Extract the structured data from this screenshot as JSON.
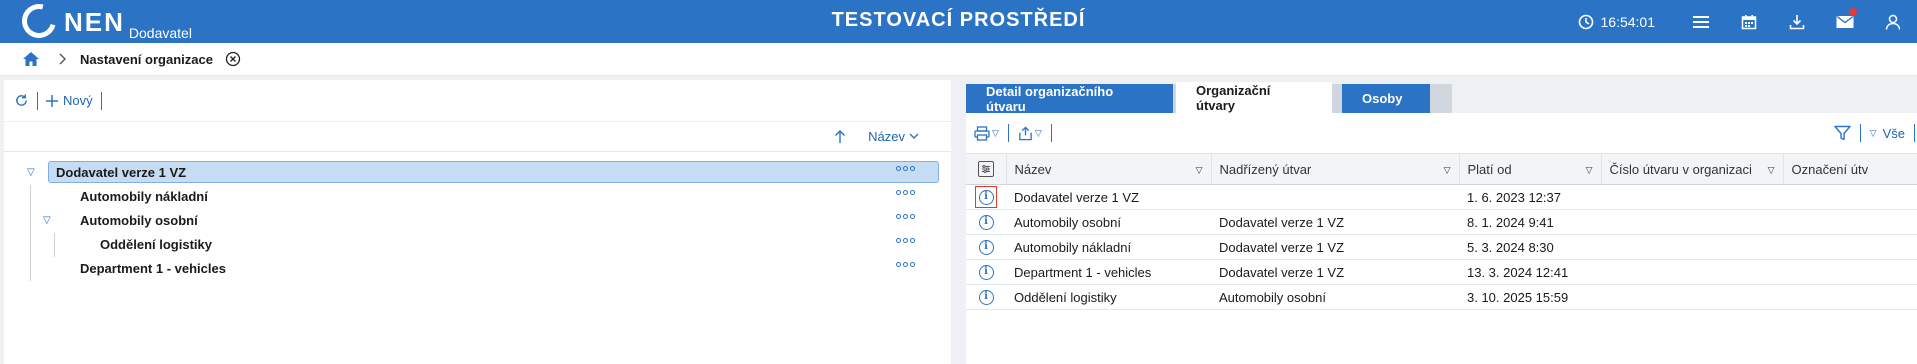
{
  "header": {
    "logo_text": "NEN",
    "logo_sub": "Dodavatel",
    "environment_title": "TESTOVACÍ PROSTŘEDÍ",
    "clock_time": "16:54:01",
    "accent_color": "#2b73c4",
    "icons": [
      "clock-icon",
      "menu-icon",
      "calendar-icon",
      "download-icon",
      "mail-icon",
      "user-icon"
    ]
  },
  "breadcrumb": {
    "title": "Nastavení organizace"
  },
  "left_panel": {
    "toolbar": {
      "new_label": "Nový"
    },
    "sort": {
      "label": "Název"
    },
    "tree": [
      {
        "label": "Dodavatel verze 1 VZ",
        "level": 0,
        "expanded": true,
        "selected": true
      },
      {
        "label": "Automobily nákladní",
        "level": 1,
        "expanded": false,
        "selected": false
      },
      {
        "label": "Automobily osobní",
        "level": 1,
        "expanded": true,
        "selected": false
      },
      {
        "label": "Oddělení logistiky",
        "level": 2,
        "expanded": false,
        "selected": false
      },
      {
        "label": "Department 1 - vehicles",
        "level": 1,
        "expanded": false,
        "selected": false
      }
    ]
  },
  "right_panel": {
    "tabs": [
      {
        "label": "Detail organizačního útvaru",
        "active": false
      },
      {
        "label": "Organizační útvary",
        "active": true
      },
      {
        "label": "Osoby",
        "active": false
      }
    ],
    "toolbar": {
      "filter_label": "Vše"
    },
    "table": {
      "columns": [
        "Název",
        "Nadřízený útvar",
        "Platí od",
        "Číslo útvaru v organizaci",
        "Označení útv"
      ],
      "rows": [
        {
          "name": "Dodavatel verze 1 VZ",
          "parent": "",
          "valid_from": "1. 6. 2023 12:37",
          "unit_no": "",
          "designation": ""
        },
        {
          "name": "Automobily osobní",
          "parent": "Dodavatel verze 1 VZ",
          "valid_from": "8. 1. 2024 9:41",
          "unit_no": "",
          "designation": ""
        },
        {
          "name": "Automobily nákladní",
          "parent": "Dodavatel verze 1 VZ",
          "valid_from": "5. 3. 2024 8:30",
          "unit_no": "",
          "designation": ""
        },
        {
          "name": "Department 1 - vehicles",
          "parent": "Dodavatel verze 1 VZ",
          "valid_from": "13. 3. 2024 12:41",
          "unit_no": "",
          "designation": ""
        },
        {
          "name": "Oddělení logistiky",
          "parent": "Automobily osobní",
          "valid_from": "3. 10. 2025 15:59",
          "unit_no": "",
          "designation": ""
        }
      ]
    }
  }
}
